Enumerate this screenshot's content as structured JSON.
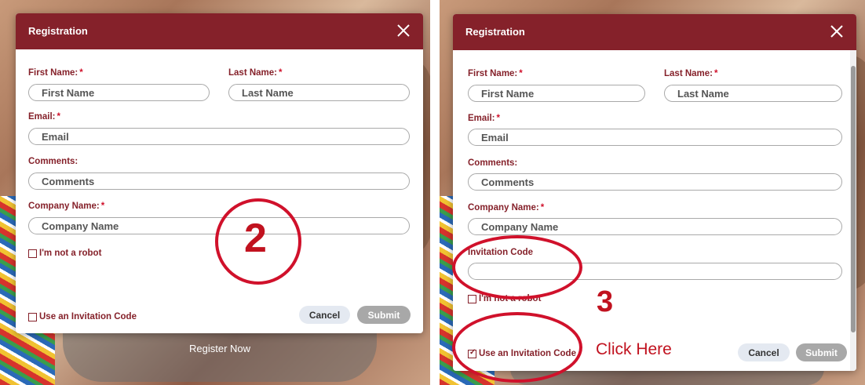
{
  "left": {
    "register_label": "Register Now",
    "modal": {
      "title": "Registration",
      "first_name": {
        "label": "First Name:",
        "placeholder": "First Name"
      },
      "last_name": {
        "label": "Last Name:",
        "placeholder": "Last Name"
      },
      "email": {
        "label": "Email:",
        "placeholder": "Email"
      },
      "comments": {
        "label": "Comments:",
        "placeholder": "Comments"
      },
      "company": {
        "label": "Company Name:",
        "placeholder": "Company Name"
      },
      "required_marker": "*",
      "robot_label": "I'm not a robot",
      "invitation_toggle": {
        "label": "Use an Invitation Code",
        "checked": false
      },
      "cancel_label": "Cancel",
      "submit_label": "Submit"
    },
    "annotation_step": "2"
  },
  "right": {
    "modal": {
      "title": "Registration",
      "first_name": {
        "label": "First Name:",
        "placeholder": "First Name"
      },
      "last_name": {
        "label": "Last Name:",
        "placeholder": "Last Name"
      },
      "email": {
        "label": "Email:",
        "placeholder": "Email"
      },
      "comments": {
        "label": "Comments:",
        "placeholder": "Comments"
      },
      "company": {
        "label": "Company Name:",
        "placeholder": "Company Name"
      },
      "invitation_code": {
        "label": "Invitation Code",
        "value": ""
      },
      "required_marker": "*",
      "robot_label": "I'm not a robot",
      "invitation_toggle": {
        "label": "Use an Invitation Code",
        "checked": true
      },
      "cancel_label": "Cancel",
      "submit_label": "Submit"
    },
    "annotation_step": "3",
    "annotation_text": "Click Here"
  },
  "colors": {
    "header": "#85212a",
    "label": "#85212a",
    "required": "#d0112b",
    "annotation": "#c1121f",
    "submit_disabled": "#a8a8a8",
    "cancel_bg": "#e4e9f1"
  }
}
